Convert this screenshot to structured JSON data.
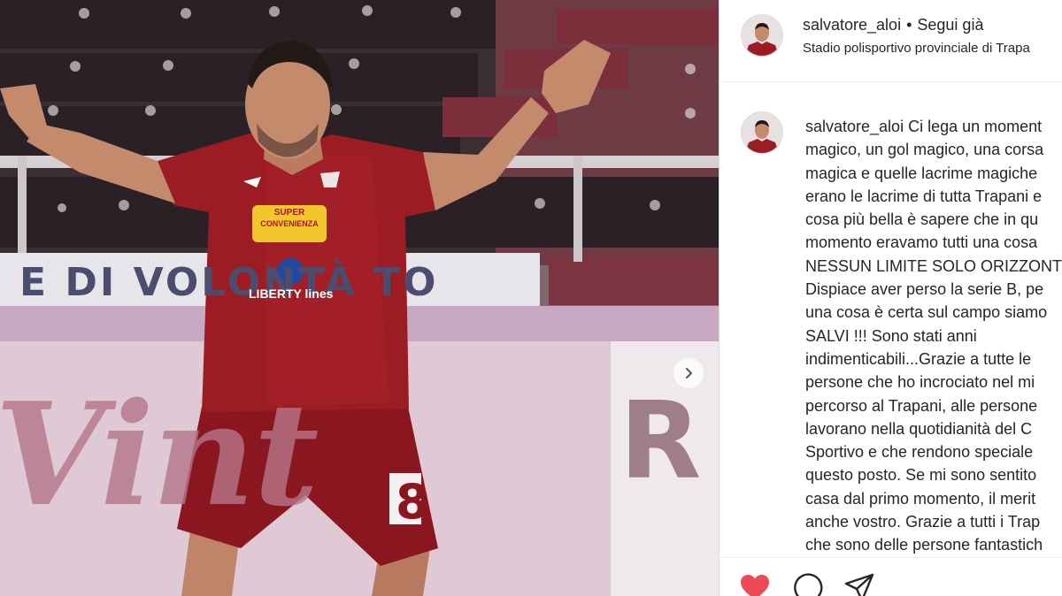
{
  "post": {
    "username": "salvatore_aloi",
    "separator": "•",
    "follow_status": "Segui già",
    "location": "Stadio polisportivo provinciale di Trapa"
  },
  "comment": {
    "username": "salvatore_aloi",
    "text": " Ci lega un moment\nmagico, un gol magico, una corsa\nmagica e quelle lacrime magiche\nerano le lacrime di tutta Trapani e\ncosa più bella è sapere che in qu\nmomento eravamo tutti una cosa\nNESSUN LIMITE SOLO ORIZZONT\nDispiace aver perso la serie B, pe\nuna cosa è certa sul campo siamo\nSALVI !!! Sono stati anni\nindimenticabili...Grazie a tutte le\npersone che ho incrociato nel mi\npercorso al Trapani, alle persone\nlavorano nella quotidianità del C\nSportivo e che rendono speciale\nquesto posto. Se mi sono sentito\ncasa dal primo momento, il merit\nanche vostro. Grazie a tutti i Trap\nche sono delle persone fantastich"
  },
  "photo": {
    "banner_text": "E DI VOLONTÀ  TO",
    "board_text": "Vint",
    "board_text_right": "R"
  },
  "shirt": {
    "sponsor_top_line1": "SUPER",
    "sponsor_top_line2": "CONVENIENZA",
    "sponsor_main": "LIBERTY lines",
    "number": "8"
  },
  "icons": {
    "like": "heart-icon",
    "comment": "comment-icon",
    "share": "share-icon",
    "next": "chevron-right-icon"
  },
  "colors": {
    "like": "#ed4956",
    "jersey": "#9c1c24",
    "text": "#262626"
  }
}
